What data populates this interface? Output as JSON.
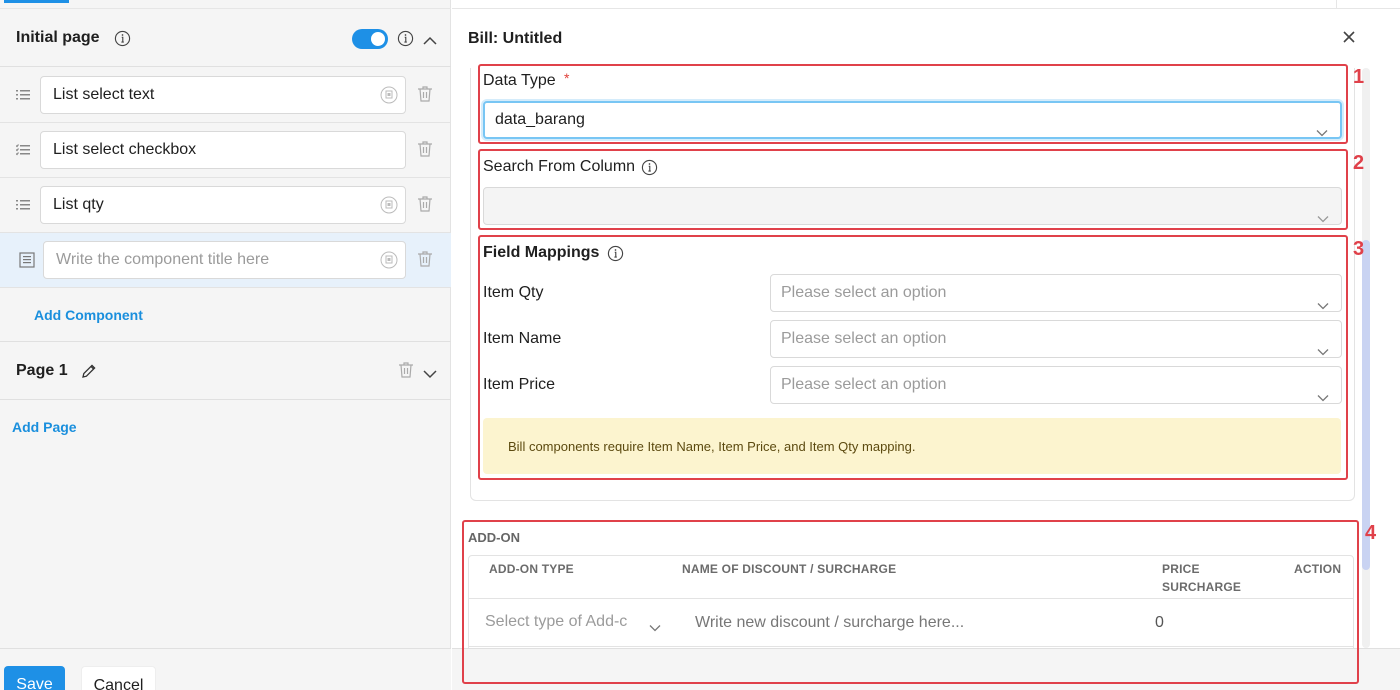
{
  "left_pane": {
    "initial_page": {
      "title": "Initial page",
      "toggle_on": true,
      "components": [
        {
          "title": "List select text"
        },
        {
          "title": "List select checkbox"
        },
        {
          "title": "List qty"
        },
        {
          "title": "",
          "placeholder": "Write the component title here"
        }
      ],
      "add_component_label": "Add Component"
    },
    "page_1": {
      "title": "Page 1"
    },
    "add_page_label": "Add Page",
    "save_label": "Save",
    "cancel_label": "Cancel"
  },
  "right_pane": {
    "title": "Bill: Untitled",
    "data_type": {
      "label": "Data Type",
      "required_mark": "*",
      "value": "data_barang"
    },
    "search_from_column": {
      "label": "Search From Column",
      "value": ""
    },
    "field_mappings": {
      "label": "Field Mappings",
      "rows": [
        {
          "label": "Item Qty",
          "placeholder": "Please select an option"
        },
        {
          "label": "Item Name",
          "placeholder": "Please select an option"
        },
        {
          "label": "Item Price",
          "placeholder": "Please select an option"
        }
      ],
      "warning": "Bill components require Item Name, Item Price, and Item Qty mapping."
    },
    "add_on": {
      "section_title": "ADD-ON",
      "columns": [
        "ADD-ON TYPE",
        "NAME OF DISCOUNT / SURCHARGE",
        "PRICE SURCHARGE",
        "ACTION"
      ],
      "row": {
        "type_placeholder": "Select type of Add-c",
        "name_placeholder": "Write new discount / surcharge here...",
        "price": "0"
      }
    },
    "annotations": [
      "1",
      "2",
      "3",
      "4"
    ]
  },
  "colors": {
    "accent": "#1e90e6",
    "link": "#1a8fdd",
    "annotation": "#e0414a",
    "warning_bg": "#fcf4cf",
    "required": "#e0413a"
  }
}
